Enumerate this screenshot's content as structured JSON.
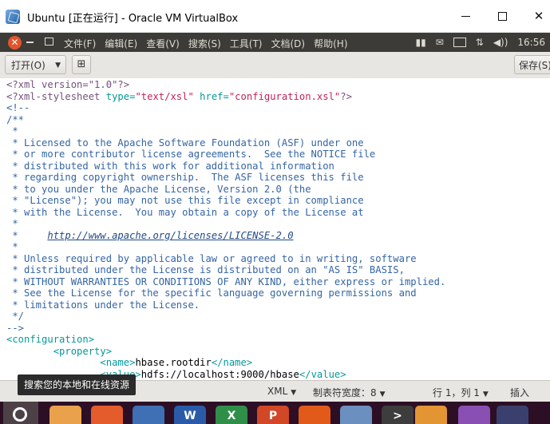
{
  "window": {
    "title": "Ubuntu [正在运行] - Oracle VM VirtualBox",
    "minimize_label": "—",
    "maximize_label": "☐",
    "close_label": "✕"
  },
  "ubuntu_bar": {
    "close_glyph": "✕",
    "menu": [
      "文件(F)",
      "编辑(E)",
      "查看(V)",
      "搜索(S)",
      "工具(T)",
      "文档(D)",
      "帮助(H)"
    ],
    "indicators": {
      "input": "",
      "transfer": "⇅",
      "volume": "◀))",
      "time": "16:56"
    }
  },
  "toolbar": {
    "open_label": "打开(O)",
    "save_label": "保存(S)"
  },
  "editor": {
    "lines": [
      {
        "parts": [
          {
            "t": "<?xml version=\"1.0\"?>",
            "c": "c-purple"
          }
        ]
      },
      {
        "parts": [
          {
            "t": "<?xml-stylesheet",
            "c": "c-purple"
          },
          {
            "t": " type=",
            "c": "c-teal"
          },
          {
            "t": "\"text/xsl\"",
            "c": "c-red"
          },
          {
            "t": " href=",
            "c": "c-teal"
          },
          {
            "t": "\"configuration.xsl\"",
            "c": "c-red"
          },
          {
            "t": "?>",
            "c": "c-purple"
          }
        ]
      },
      {
        "parts": [
          {
            "t": "<!--",
            "c": "c-blue"
          }
        ]
      },
      {
        "parts": [
          {
            "t": "/**",
            "c": "c-blue"
          }
        ]
      },
      {
        "parts": [
          {
            "t": " *",
            "c": "c-blue"
          }
        ]
      },
      {
        "parts": [
          {
            "t": " * Licensed to the Apache Software Foundation (ASF) under one",
            "c": "c-blue"
          }
        ]
      },
      {
        "parts": [
          {
            "t": " * or more contributor license agreements.  See the NOTICE file",
            "c": "c-blue"
          }
        ]
      },
      {
        "parts": [
          {
            "t": " * distributed with this work for additional information",
            "c": "c-blue"
          }
        ]
      },
      {
        "parts": [
          {
            "t": " * regarding copyright ownership.  The ASF licenses this file",
            "c": "c-blue"
          }
        ]
      },
      {
        "parts": [
          {
            "t": " * to you under the Apache License, Version 2.0 (the",
            "c": "c-blue"
          }
        ]
      },
      {
        "parts": [
          {
            "t": " * \"License\"); you may not use this file except in compliance",
            "c": "c-blue"
          }
        ]
      },
      {
        "parts": [
          {
            "t": " * with the License.  You may obtain a copy of the License at",
            "c": "c-blue"
          }
        ]
      },
      {
        "parts": [
          {
            "t": " *",
            "c": "c-blue"
          }
        ]
      },
      {
        "parts": [
          {
            "t": " *     ",
            "c": "c-blue"
          },
          {
            "t": "http://www.apache.org/licenses/LICENSE-2.0",
            "c": "link"
          }
        ]
      },
      {
        "parts": [
          {
            "t": " *",
            "c": "c-blue"
          }
        ]
      },
      {
        "parts": [
          {
            "t": " * Unless required by applicable law or agreed to in writing, software",
            "c": "c-blue"
          }
        ]
      },
      {
        "parts": [
          {
            "t": " * distributed under the License is distributed on an \"AS IS\" BASIS,",
            "c": "c-blue"
          }
        ]
      },
      {
        "parts": [
          {
            "t": " * WITHOUT WARRANTIES OR CONDITIONS OF ANY KIND, either express or implied.",
            "c": "c-blue"
          }
        ]
      },
      {
        "parts": [
          {
            "t": " * See the License for the specific language governing permissions and",
            "c": "c-blue"
          }
        ]
      },
      {
        "parts": [
          {
            "t": " * limitations under the License.",
            "c": "c-blue"
          }
        ]
      },
      {
        "parts": [
          {
            "t": " */",
            "c": "c-blue"
          }
        ]
      },
      {
        "parts": [
          {
            "t": "-->",
            "c": "c-blue"
          }
        ]
      },
      {
        "parts": [
          {
            "t": "<configuration>",
            "c": "c-teal"
          }
        ]
      },
      {
        "parts": [
          {
            "t": "        <property>",
            "c": "c-teal"
          }
        ]
      },
      {
        "parts": [
          {
            "t": "                <name>",
            "c": "c-teal"
          },
          {
            "t": "hbase.rootdir",
            "c": ""
          },
          {
            "t": "</name>",
            "c": "c-teal"
          }
        ]
      },
      {
        "parts": [
          {
            "t": "                <value>",
            "c": "c-teal"
          },
          {
            "t": "hdfs://localhost:9000/hbase",
            "c": ""
          },
          {
            "t": "</value>",
            "c": "c-teal"
          }
        ]
      }
    ]
  },
  "statusbar": {
    "language": "XML",
    "tab_width": "制表符宽度：8",
    "position": "行 1，列 1",
    "mode": "插入"
  },
  "tooltip": "搜索您的本地和在线资源",
  "dock": {
    "items": [
      "ubuntu-dash",
      "files",
      "firefox",
      "search",
      "word",
      "excel",
      "powerpoint",
      "software-center",
      "cloud",
      "terminal",
      "software-updater",
      "system-monitor",
      "text-editor"
    ]
  }
}
